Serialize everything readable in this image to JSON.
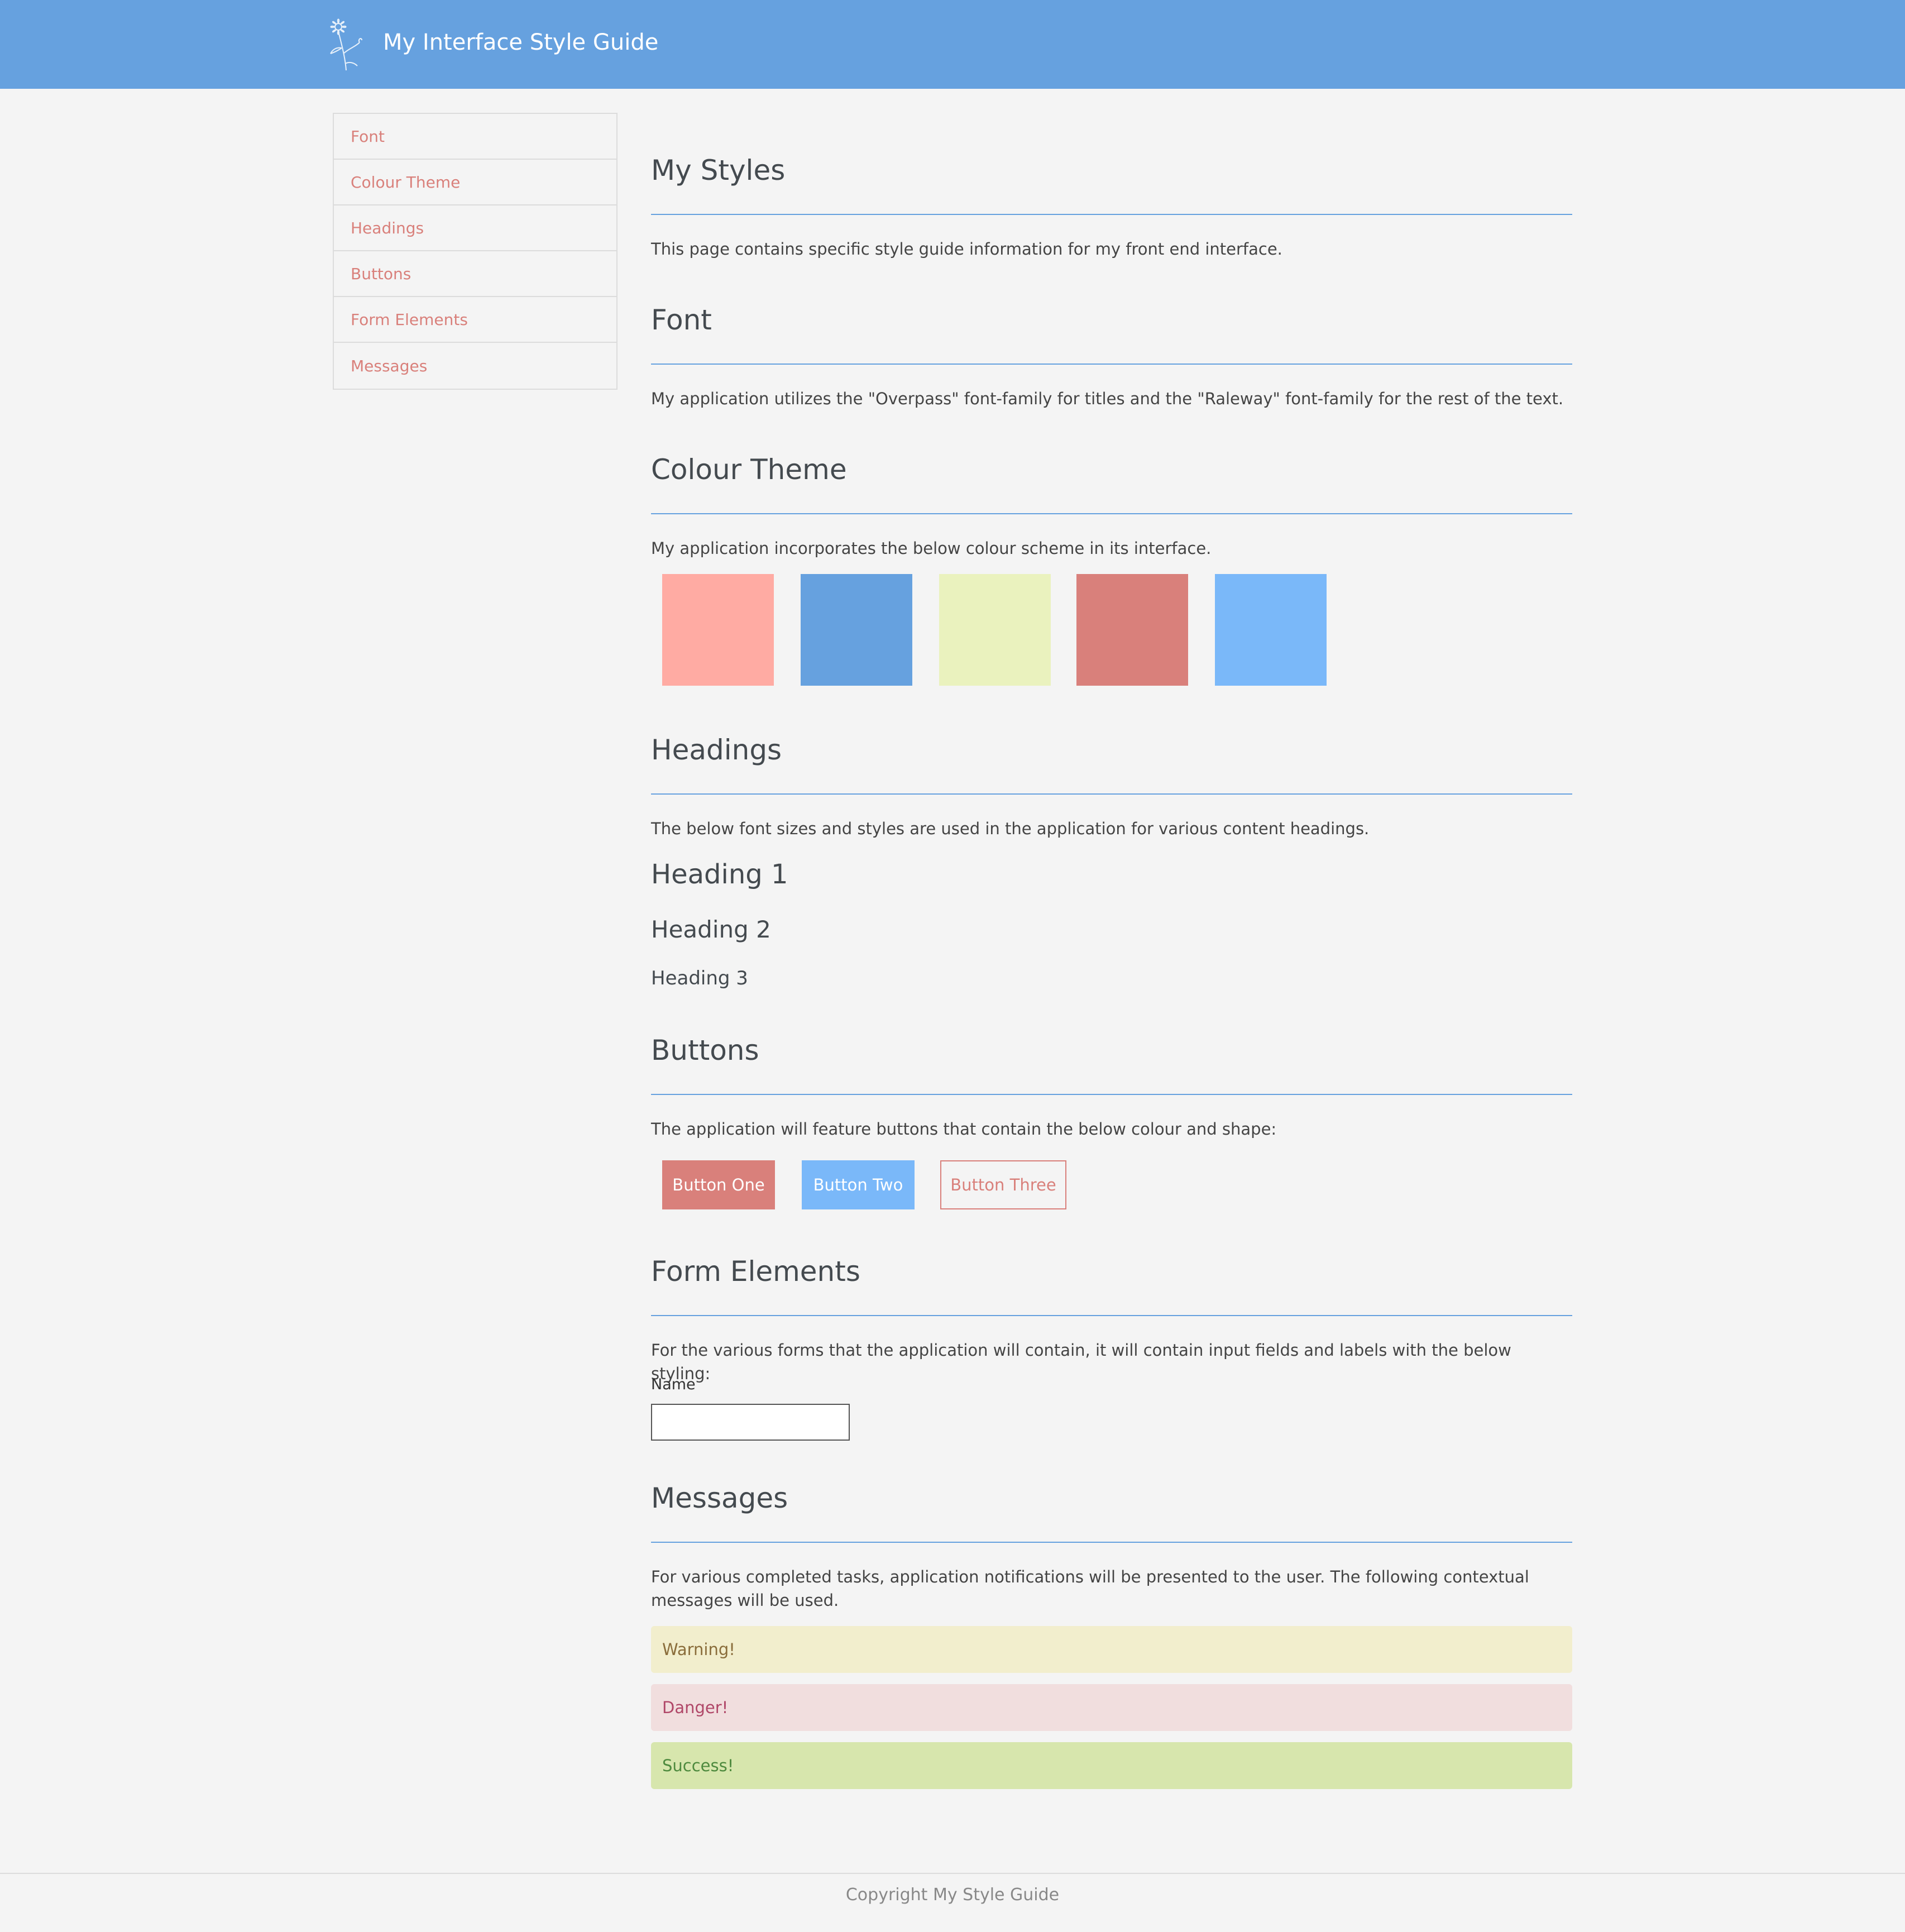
{
  "header": {
    "title": "My Interface Style Guide",
    "logo_icon": "flower-icon",
    "background": "#66a1df"
  },
  "sidebar": {
    "items": [
      {
        "label": "Font"
      },
      {
        "label": "Colour Theme"
      },
      {
        "label": "Headings"
      },
      {
        "label": "Buttons"
      },
      {
        "label": "Form Elements"
      },
      {
        "label": "Messages"
      }
    ]
  },
  "sections": {
    "intro": {
      "title": "My Styles",
      "text": "This page contains specific style guide information for my front end interface."
    },
    "font": {
      "title": "Font",
      "text": "My application utilizes the \"Overpass\" font-family for titles and the \"Raleway\" font-family for the rest of the text."
    },
    "colour": {
      "title": "Colour Theme",
      "text": "My application incorporates the below colour scheme in its interface.",
      "swatches": [
        "#ffaba3",
        "#66a1df",
        "#eaf2be",
        "#d9807b",
        "#7ab8f9"
      ]
    },
    "headings": {
      "title": "Headings",
      "text": "The below font sizes and styles are used in the application for various content headings.",
      "h1": "Heading 1",
      "h2": "Heading 2",
      "h3": "Heading 3"
    },
    "buttons": {
      "title": "Buttons",
      "text": "The application will feature buttons that contain the below colour and shape:",
      "one": "Button One",
      "two": "Button Two",
      "three": "Button Three"
    },
    "forms": {
      "title": "Form Elements",
      "text": "For the various forms that the application will contain, it will contain input fields and labels with the below styling:",
      "name_label": "Name",
      "name_value": ""
    },
    "messages": {
      "title": "Messages",
      "text": "For various completed tasks, application notifications will be presented to the user. The following contextual messages will be used.",
      "warning": "Warning!",
      "danger": "Danger!",
      "success": "Success!"
    }
  },
  "footer": {
    "text": "Copyright My Style Guide"
  }
}
